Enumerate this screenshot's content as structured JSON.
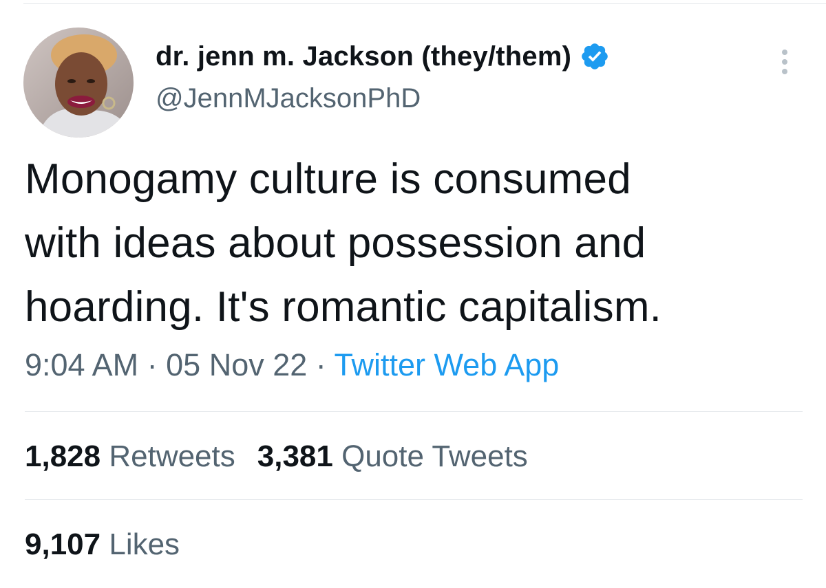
{
  "author": {
    "display_name": "dr. jenn m. Jackson (they/them)",
    "handle": "@JennMJacksonPhD",
    "verified": true,
    "verified_color": "#1d9bf0"
  },
  "icons": {
    "verified": "verified-badge-icon",
    "more": "more-vertical-icon"
  },
  "tweet": {
    "lines": [
      "Monogamy culture is consumed",
      "with ideas about possession and",
      "hoarding. It's romantic capitalism."
    ],
    "time": "9:04 AM",
    "date": "05 Nov 22",
    "separator": "·",
    "source": "Twitter Web App"
  },
  "stats": {
    "retweets_count": "1,828",
    "retweets_label": "Retweets",
    "quotes_count": "3,381",
    "quotes_label": "Quote Tweets",
    "likes_count": "9,107",
    "likes_label": "Likes"
  },
  "colors": {
    "text": "#0f1419",
    "secondary": "#536471",
    "link": "#1d9bf0",
    "divider": "#e4e8eb"
  }
}
